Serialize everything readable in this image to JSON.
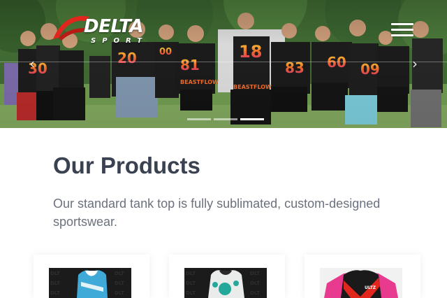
{
  "header": {
    "logo": {
      "word": "DELTA",
      "sub": "SPORT"
    },
    "menu_icon": "hamburger-menu-icon"
  },
  "hero": {
    "slide_prev_icon": "chevron-left-icon",
    "slide_next_icon": "chevron-right-icon",
    "slide_count": 3,
    "active_slide": 3,
    "jersey_numbers": [
      "30",
      "20",
      "00",
      "81",
      "18",
      "83",
      "60",
      "09"
    ],
    "jersey_text": "BEASTFLOW"
  },
  "main": {
    "title": "Our Products",
    "description": "Our standard tank top is fully sublimated, custom-designed sportswear."
  },
  "products": [
    {
      "thumb": "blue-tank-top"
    },
    {
      "thumb": "white-teal-tank-top"
    },
    {
      "thumb": "red-black-jersey"
    }
  ],
  "colors": {
    "title": "#3a4150",
    "body_text": "#6b717d",
    "brand_red": "#e0261d",
    "jersey_black": "#1a1a1a",
    "jersey_pink": "#e83a8f"
  }
}
